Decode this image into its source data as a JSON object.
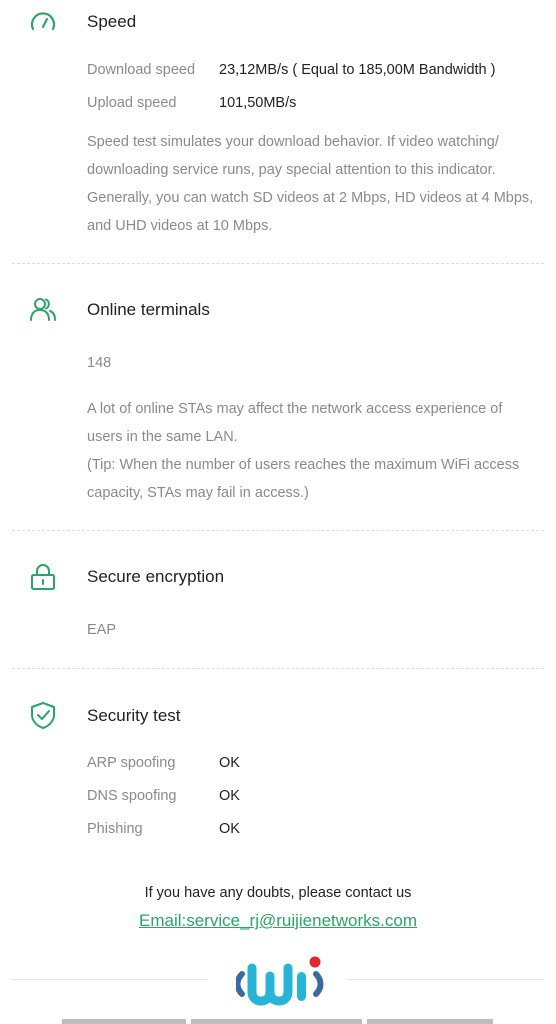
{
  "speed": {
    "title": "Speed",
    "icon": "speedometer-icon",
    "download_label": "Download speed",
    "download_value": "23,12MB/s ( Equal to 185,00M Bandwidth )",
    "upload_label": "Upload speed",
    "upload_value": "101,50MB/s",
    "description": "Speed test simulates your download behavior. If video watching/ downloading service runs, pay special attention to this indicator. Generally, you can watch SD videos at 2 Mbps, HD videos at 4 Mbps, and UHD videos at 10 Mbps."
  },
  "terminals": {
    "title": "Online terminals",
    "icon": "users-icon",
    "count": "148",
    "description_line1": "A lot of online STAs may affect the network access experience of users in the same LAN.",
    "description_line2": "(Tip: When the number of users reaches the maximum WiFi access capacity, STAs may fail in access.)"
  },
  "encryption": {
    "title": "Secure encryption",
    "icon": "lock-icon",
    "value": "EAP"
  },
  "security": {
    "title": "Security test",
    "icon": "shield-check-icon",
    "rows": [
      {
        "label": "ARP spoofing",
        "value": "OK"
      },
      {
        "label": "DNS spoofing",
        "value": "OK"
      },
      {
        "label": "Phishing",
        "value": "OK"
      }
    ]
  },
  "footer": {
    "contact_text": "If you have any doubts, please contact us",
    "email_link": "Email:service_rj@ruijienetworks.com",
    "logo": "ruijie-wifi-logo"
  },
  "colors": {
    "accent": "#2aa568",
    "logo_blue": "#27b4d6",
    "logo_red": "#e0262f",
    "logo_dark": "#3b6aa0"
  }
}
